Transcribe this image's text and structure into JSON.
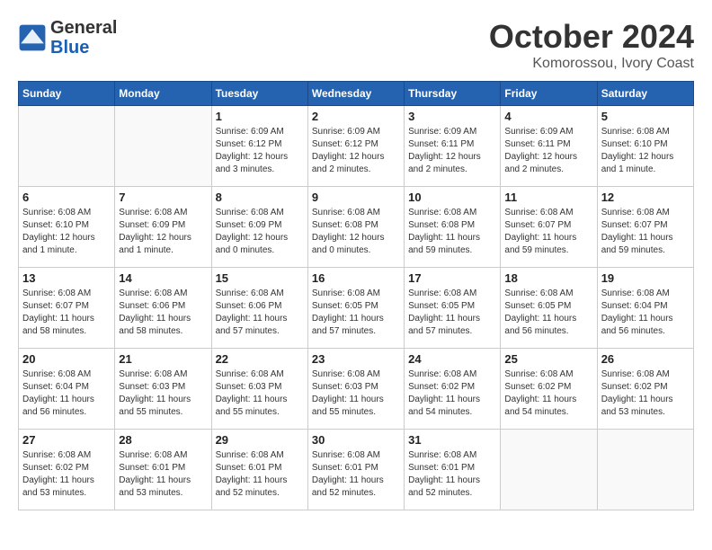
{
  "header": {
    "logo_line1": "General",
    "logo_line2": "Blue",
    "month": "October 2024",
    "location": "Komorossou, Ivory Coast"
  },
  "weekdays": [
    "Sunday",
    "Monday",
    "Tuesday",
    "Wednesday",
    "Thursday",
    "Friday",
    "Saturday"
  ],
  "weeks": [
    [
      {
        "day": "",
        "info": ""
      },
      {
        "day": "",
        "info": ""
      },
      {
        "day": "1",
        "info": "Sunrise: 6:09 AM\nSunset: 6:12 PM\nDaylight: 12 hours and 3 minutes."
      },
      {
        "day": "2",
        "info": "Sunrise: 6:09 AM\nSunset: 6:12 PM\nDaylight: 12 hours and 2 minutes."
      },
      {
        "day": "3",
        "info": "Sunrise: 6:09 AM\nSunset: 6:11 PM\nDaylight: 12 hours and 2 minutes."
      },
      {
        "day": "4",
        "info": "Sunrise: 6:09 AM\nSunset: 6:11 PM\nDaylight: 12 hours and 2 minutes."
      },
      {
        "day": "5",
        "info": "Sunrise: 6:08 AM\nSunset: 6:10 PM\nDaylight: 12 hours and 1 minute."
      }
    ],
    [
      {
        "day": "6",
        "info": "Sunrise: 6:08 AM\nSunset: 6:10 PM\nDaylight: 12 hours and 1 minute."
      },
      {
        "day": "7",
        "info": "Sunrise: 6:08 AM\nSunset: 6:09 PM\nDaylight: 12 hours and 1 minute."
      },
      {
        "day": "8",
        "info": "Sunrise: 6:08 AM\nSunset: 6:09 PM\nDaylight: 12 hours and 0 minutes."
      },
      {
        "day": "9",
        "info": "Sunrise: 6:08 AM\nSunset: 6:08 PM\nDaylight: 12 hours and 0 minutes."
      },
      {
        "day": "10",
        "info": "Sunrise: 6:08 AM\nSunset: 6:08 PM\nDaylight: 11 hours and 59 minutes."
      },
      {
        "day": "11",
        "info": "Sunrise: 6:08 AM\nSunset: 6:07 PM\nDaylight: 11 hours and 59 minutes."
      },
      {
        "day": "12",
        "info": "Sunrise: 6:08 AM\nSunset: 6:07 PM\nDaylight: 11 hours and 59 minutes."
      }
    ],
    [
      {
        "day": "13",
        "info": "Sunrise: 6:08 AM\nSunset: 6:07 PM\nDaylight: 11 hours and 58 minutes."
      },
      {
        "day": "14",
        "info": "Sunrise: 6:08 AM\nSunset: 6:06 PM\nDaylight: 11 hours and 58 minutes."
      },
      {
        "day": "15",
        "info": "Sunrise: 6:08 AM\nSunset: 6:06 PM\nDaylight: 11 hours and 57 minutes."
      },
      {
        "day": "16",
        "info": "Sunrise: 6:08 AM\nSunset: 6:05 PM\nDaylight: 11 hours and 57 minutes."
      },
      {
        "day": "17",
        "info": "Sunrise: 6:08 AM\nSunset: 6:05 PM\nDaylight: 11 hours and 57 minutes."
      },
      {
        "day": "18",
        "info": "Sunrise: 6:08 AM\nSunset: 6:05 PM\nDaylight: 11 hours and 56 minutes."
      },
      {
        "day": "19",
        "info": "Sunrise: 6:08 AM\nSunset: 6:04 PM\nDaylight: 11 hours and 56 minutes."
      }
    ],
    [
      {
        "day": "20",
        "info": "Sunrise: 6:08 AM\nSunset: 6:04 PM\nDaylight: 11 hours and 56 minutes."
      },
      {
        "day": "21",
        "info": "Sunrise: 6:08 AM\nSunset: 6:03 PM\nDaylight: 11 hours and 55 minutes."
      },
      {
        "day": "22",
        "info": "Sunrise: 6:08 AM\nSunset: 6:03 PM\nDaylight: 11 hours and 55 minutes."
      },
      {
        "day": "23",
        "info": "Sunrise: 6:08 AM\nSunset: 6:03 PM\nDaylight: 11 hours and 55 minutes."
      },
      {
        "day": "24",
        "info": "Sunrise: 6:08 AM\nSunset: 6:02 PM\nDaylight: 11 hours and 54 minutes."
      },
      {
        "day": "25",
        "info": "Sunrise: 6:08 AM\nSunset: 6:02 PM\nDaylight: 11 hours and 54 minutes."
      },
      {
        "day": "26",
        "info": "Sunrise: 6:08 AM\nSunset: 6:02 PM\nDaylight: 11 hours and 53 minutes."
      }
    ],
    [
      {
        "day": "27",
        "info": "Sunrise: 6:08 AM\nSunset: 6:02 PM\nDaylight: 11 hours and 53 minutes."
      },
      {
        "day": "28",
        "info": "Sunrise: 6:08 AM\nSunset: 6:01 PM\nDaylight: 11 hours and 53 minutes."
      },
      {
        "day": "29",
        "info": "Sunrise: 6:08 AM\nSunset: 6:01 PM\nDaylight: 11 hours and 52 minutes."
      },
      {
        "day": "30",
        "info": "Sunrise: 6:08 AM\nSunset: 6:01 PM\nDaylight: 11 hours and 52 minutes."
      },
      {
        "day": "31",
        "info": "Sunrise: 6:08 AM\nSunset: 6:01 PM\nDaylight: 11 hours and 52 minutes."
      },
      {
        "day": "",
        "info": ""
      },
      {
        "day": "",
        "info": ""
      }
    ]
  ]
}
